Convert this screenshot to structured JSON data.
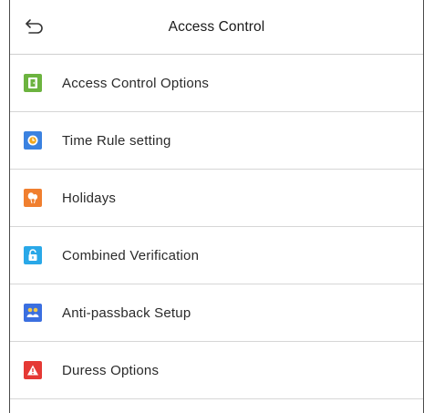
{
  "header": {
    "title": "Access Control",
    "back_icon": "back-arrow-icon"
  },
  "menu": {
    "items": [
      {
        "label": "Access Control Options",
        "icon": "door-icon",
        "color": "#6cb33f"
      },
      {
        "label": "Time Rule setting",
        "icon": "clock-icon",
        "color": "#3b82e0"
      },
      {
        "label": "Holidays",
        "icon": "balloon-icon",
        "color": "#f07f2f"
      },
      {
        "label": "Combined Verification",
        "icon": "unlock-icon",
        "color": "#29a8e8"
      },
      {
        "label": "Anti-passback Setup",
        "icon": "users-icon",
        "color": "#3b6fe0"
      },
      {
        "label": "Duress Options",
        "icon": "warning-icon",
        "color": "#e53935"
      }
    ]
  }
}
